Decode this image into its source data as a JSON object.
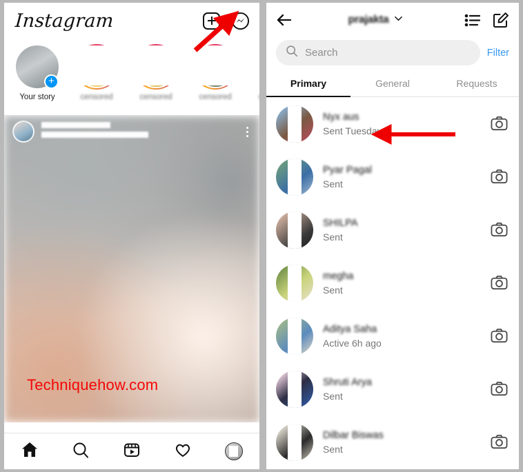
{
  "colors": {
    "ig_blue": "#0095f6",
    "filter_blue": "#3797f0",
    "arrow_red": "#ee0000",
    "watermark_red": "#f40707",
    "text_primary": "#141414",
    "text_secondary": "#767676",
    "search_bg": "#efefef",
    "frame_gray": "#b9b9b9"
  },
  "left_phone": {
    "header": {
      "logo_text": "Instagram",
      "add_icon": "plus-square-icon",
      "messenger_icon": "messenger-icon"
    },
    "stories": [
      {
        "label": "Your story",
        "add_badge": "+",
        "censored": false,
        "ring": false
      },
      {
        "label": "",
        "censored": true,
        "ring": true
      },
      {
        "label": "",
        "censored": true,
        "ring": true
      },
      {
        "label": "",
        "censored": true,
        "ring": true
      },
      {
        "label": "",
        "censored": true,
        "ring": true
      }
    ],
    "post": {
      "author_name_censored": "",
      "author_subtitle_censored": "",
      "menu_icon": "more-options-icon",
      "watermark": "Techniquehow.com"
    },
    "bottom_nav": [
      {
        "name": "home-icon",
        "label": "Home",
        "active": true
      },
      {
        "name": "search-icon",
        "label": "Search",
        "active": false
      },
      {
        "name": "reels-icon",
        "label": "Reels",
        "active": false
      },
      {
        "name": "heart-icon",
        "label": "Activity",
        "active": false
      },
      {
        "name": "profile-avatar",
        "label": "Profile",
        "active": false
      }
    ]
  },
  "right_phone": {
    "header": {
      "back_icon": "back-arrow-icon",
      "username": "prajakta",
      "chevron_icon": "chevron-down-icon",
      "list_icon": "message-requests-list-icon",
      "compose_icon": "new-message-compose-icon"
    },
    "search": {
      "placeholder": "Search",
      "icon": "search-icon",
      "filter_label": "Filter"
    },
    "tabs": [
      {
        "label": "Primary",
        "active": true
      },
      {
        "label": "General",
        "active": false
      },
      {
        "label": "Requests",
        "active": false
      }
    ],
    "chats": [
      {
        "name": "",
        "status": "Sent Tuesday",
        "action_icon": "camera-icon"
      },
      {
        "name": "",
        "status": "Sent",
        "action_icon": "camera-icon"
      },
      {
        "name": "",
        "status": "Sent",
        "action_icon": "camera-icon"
      },
      {
        "name": "",
        "status": "Sent",
        "action_icon": "camera-icon"
      },
      {
        "name": "",
        "status": "Active 6h ago",
        "action_icon": "camera-icon"
      },
      {
        "name": "",
        "status": "Sent",
        "action_icon": "camera-icon"
      },
      {
        "name": "",
        "status": "Sent",
        "action_icon": "camera-icon"
      }
    ]
  },
  "annotations": [
    {
      "id": "arrow-to-messenger",
      "type": "red-arrow",
      "points_to": "messenger-icon"
    },
    {
      "id": "arrow-to-first-chat",
      "type": "red-arrow",
      "points_to": "first-chat-name"
    }
  ]
}
